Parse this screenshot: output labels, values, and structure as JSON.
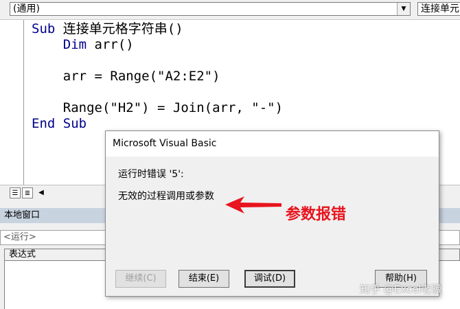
{
  "top_bar": {
    "object_combo": "(通用)",
    "procedure_combo": "连接单元"
  },
  "code": {
    "line1_kw": "Sub",
    "line1_rest": " 连接单元格字符串()",
    "line2_kw": "Dim",
    "line2_rest": " arr()",
    "line3": "arr = Range(\"A2:E2\")",
    "line4": "Range(\"H2\") = Join(arr, \"-\")",
    "line5_kw": "End Sub"
  },
  "locals": {
    "title": "本地窗口",
    "running": "<运行>",
    "expression_header": "表达式"
  },
  "dialog": {
    "title": "Microsoft Visual Basic",
    "error_line": "运行时错误 '5':",
    "error_message": "无效的过程调用或参数",
    "buttons": {
      "continue": "继续(C)",
      "end": "结束(E)",
      "debug": "调试(D)",
      "help": "帮助(H)"
    }
  },
  "annotation": {
    "text": "参数报错",
    "color": "#e8141e"
  },
  "watermark": "知乎 @Excel老骥"
}
